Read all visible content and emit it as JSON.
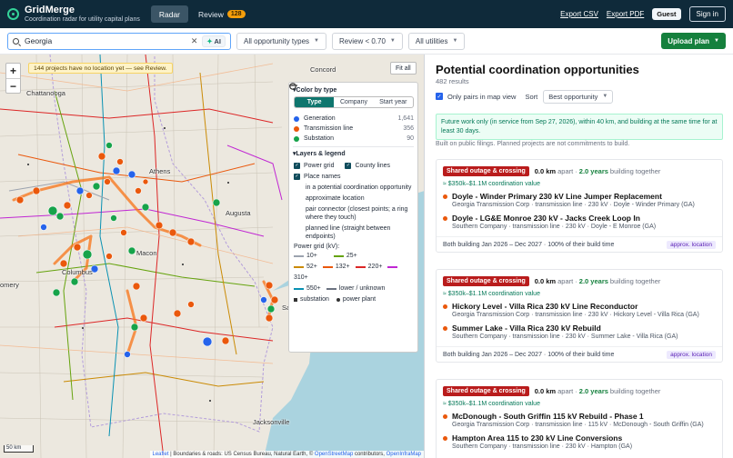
{
  "header": {
    "title": "GridMerge",
    "subtitle": "Coordination radar for utility capital plans",
    "tabs": [
      {
        "label": "Radar"
      },
      {
        "label": "Review",
        "badge": "128"
      }
    ],
    "export_csv": "Export CSV",
    "export_pdf": "Export PDF",
    "guest": "Guest",
    "sign_in": "Sign in"
  },
  "filters": {
    "search_value": "Georgia",
    "ai_label": "AI",
    "types": "All opportunity types",
    "review": "Review < 0.70",
    "utilities": "All utilities",
    "upload": "Upload plan"
  },
  "map": {
    "no_location": "144 projects have no location yet — see Review.",
    "fit_all": "Fit all",
    "scale": "50 km",
    "attribution_link": "Leaflet",
    "attribution_text": " | Boundaries & roads: US Census Bureau, Natural Earth, © ",
    "attribution_osm": "OpenStreetMap",
    "attribution_text2": " contributors, ",
    "attribution_oim": "OpenInfraMap",
    "cities": [
      "Concord",
      "Chattanooga",
      "Athens",
      "Augusta",
      "Macon",
      "Columbus",
      "Savannah",
      "Jacksonville",
      "omery"
    ]
  },
  "legend": {
    "color_by": "Color by type",
    "seg": [
      "Type",
      "Company",
      "Start year"
    ],
    "types": [
      {
        "label": "Generation",
        "count": "1,641",
        "color": "#2563eb"
      },
      {
        "label": "Transmission line",
        "count": "356",
        "color": "#ea580c"
      },
      {
        "label": "Substation",
        "count": "90",
        "color": "#16a34a"
      }
    ],
    "layers_title": "Layers & legend",
    "power_grid": "Power grid",
    "county_lines": "County lines",
    "place_names": "Place names",
    "items": [
      "in a potential coordination opportunity",
      "approximate location",
      "pair connector (closest points; a ring where they touch)",
      "planned line (straight between endpoints)"
    ],
    "power_grid_kv": "Power grid (kV):",
    "kv": [
      {
        "label": "10+",
        "color": "#9ca3af"
      },
      {
        "label": "25+",
        "color": "#65a30d"
      },
      {
        "label": "52+",
        "color": "#ca8a04"
      },
      {
        "label": "132+",
        "color": "#ea580c"
      },
      {
        "label": "220+",
        "color": "#dc2626"
      },
      {
        "label": "310+",
        "color": "#c026d3"
      },
      {
        "label": "550+",
        "color": "#0891b2"
      },
      {
        "label": "lower / unknown",
        "color": "#6b7280"
      }
    ],
    "substation": "substation",
    "power_plant": "power plant"
  },
  "panel": {
    "title": "Potential coordination opportunities",
    "count": "482 results",
    "only_pairs": "Only pairs in map view",
    "sort_label": "Sort",
    "sort_value": "Best opportunity",
    "notice": "Future work only (in service from Sep 27, 2026), within 40 km, and building at the same time for at least 30 days.",
    "disclaimer": "Built on public filings. Planned projects are not commitments to build.",
    "cards": [
      {
        "tag": "Shared outage & crossing",
        "km": "0.0 km",
        "apart": "apart ·",
        "years": "2.0 years",
        "building": "building together",
        "value": "≈ $350k–$1.1M coordination value",
        "projects": [
          {
            "title": "Doyle - Winder Primary 230 kV Line Jumper Replacement",
            "meta": "Georgia Transmission Corp · transmission line · 230 kV · Doyle - Winder Primary (GA)"
          },
          {
            "title": "Doyle - LG&E Monroe 230 kV - Jacks Creek Loop In",
            "meta": "Southern Company · transmission line · 230 kV · Doyle - E Monroe (GA)"
          }
        ],
        "foot": "Both building Jan 2026 – Dec 2027 · 100% of their build time",
        "approx": "approx. location"
      },
      {
        "tag": "Shared outage & crossing",
        "km": "0.0 km",
        "apart": "apart ·",
        "years": "2.0 years",
        "building": "building together",
        "value": "≈ $350k–$1.1M coordination value",
        "projects": [
          {
            "title": "Hickory Level - Villa Rica 230 kV Line Reconductor",
            "meta": "Georgia Transmission Corp · transmission line · 230 kV · Hickory Level - Villa Rica (GA)"
          },
          {
            "title": "Summer Lake - Villa Rica 230 kV Rebuild",
            "meta": "Southern Company · transmission line · 230 kV · Summer Lake - Villa Rica (GA)"
          }
        ],
        "foot": "Both building Jan 2026 – Dec 2027 · 100% of their build time",
        "approx": "approx. location"
      },
      {
        "tag": "Shared outage & crossing",
        "km": "0.0 km",
        "apart": "apart ·",
        "years": "2.0 years",
        "building": "building together",
        "value": "≈ $350k–$1.1M coordination value",
        "projects": [
          {
            "title": "McDonough - South Griffin 115 kV Rebuild - Phase 1",
            "meta": "Georgia Transmission Corp · transmission line · 115 kV · McDonough - South Griffin (GA)"
          },
          {
            "title": "Hampton Area 115 to 230 kV Line Conversions",
            "meta": "Southern Company · transmission line · 230 kV · Hampton (GA)"
          }
        ],
        "foot": "",
        "approx": ""
      }
    ]
  }
}
